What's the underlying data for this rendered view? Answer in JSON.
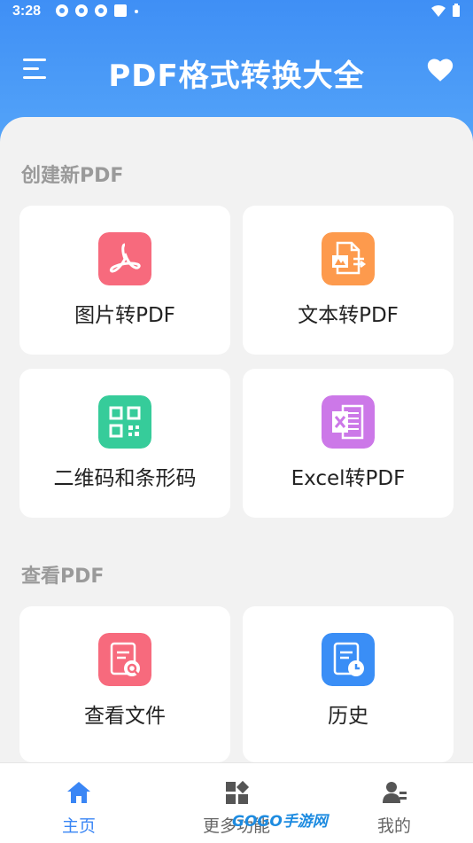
{
  "status_bar": {
    "time": "3:28"
  },
  "header": {
    "title": "PDF格式转换大全"
  },
  "sections": [
    {
      "title": "创建新PDF",
      "cards": [
        {
          "label": "图片转PDF",
          "icon": "pdf-icon",
          "color": "#f76a7d"
        },
        {
          "label": "文本转PDF",
          "icon": "document-convert-icon",
          "color": "#fd9a4d"
        },
        {
          "label": "二维码和条形码",
          "icon": "qr-code-icon",
          "color": "#36cc9a"
        },
        {
          "label": "Excel转PDF",
          "icon": "excel-icon",
          "color": "#cc78e8"
        }
      ]
    },
    {
      "title": "查看PDF",
      "cards": [
        {
          "label": "查看文件",
          "icon": "file-search-icon",
          "color": "#f76a7d"
        },
        {
          "label": "历史",
          "icon": "history-icon",
          "color": "#3a8ef6"
        }
      ]
    }
  ],
  "tabbar": {
    "items": [
      {
        "label": "主页",
        "icon": "home-icon",
        "active": true
      },
      {
        "label": "更多功能",
        "icon": "apps-icon",
        "active": false
      },
      {
        "label": "我的",
        "icon": "user-icon",
        "active": false
      }
    ]
  },
  "watermark": {
    "text": "GOGO手游网"
  },
  "colors": {
    "primary": "#3f8ff5",
    "active_tab": "#3a86f5"
  }
}
